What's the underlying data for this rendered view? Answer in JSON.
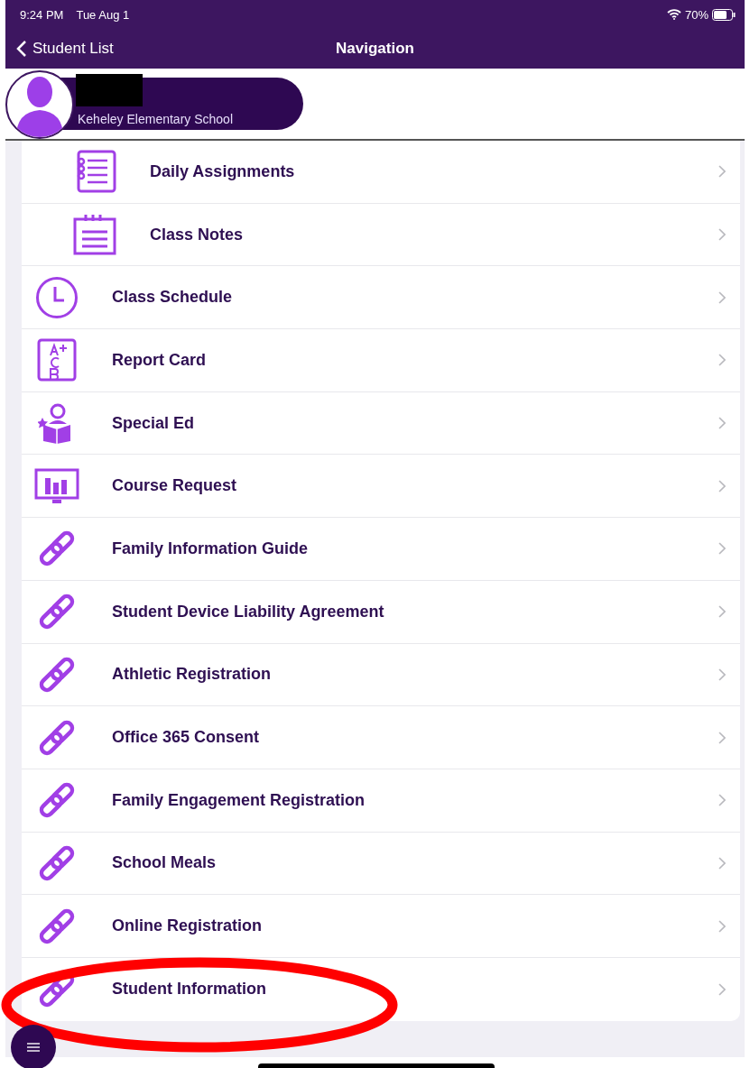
{
  "status_bar": {
    "time": "9:24 PM",
    "date": "Tue Aug 1",
    "battery": "70%"
  },
  "nav_bar": {
    "back": "Student List",
    "title": "Navigation"
  },
  "student": {
    "school": "Keheley Elementary School"
  },
  "menu_items": [
    {
      "label": "Daily Assignments",
      "kind": "notebook",
      "indented": true
    },
    {
      "label": "Class Notes",
      "kind": "notepad",
      "indented": true
    },
    {
      "label": "Class Schedule",
      "kind": "clock",
      "indented": false
    },
    {
      "label": "Report Card",
      "kind": "grades",
      "indented": false
    },
    {
      "label": "Special Ed",
      "kind": "reader",
      "indented": false
    },
    {
      "label": "Course Request",
      "kind": "chart",
      "indented": false
    },
    {
      "label": "Family Information Guide",
      "kind": "link",
      "indented": false
    },
    {
      "label": "Student Device Liability Agreement",
      "kind": "link",
      "indented": false
    },
    {
      "label": "Athletic Registration",
      "kind": "link",
      "indented": false
    },
    {
      "label": "Office 365 Consent",
      "kind": "link",
      "indented": false
    },
    {
      "label": "Family Engagement Registration",
      "kind": "link",
      "indented": false
    },
    {
      "label": "School Meals",
      "kind": "link",
      "indented": false
    },
    {
      "label": "Online Registration",
      "kind": "link",
      "indented": false
    },
    {
      "label": "Student Information",
      "kind": "link",
      "indented": false
    }
  ]
}
